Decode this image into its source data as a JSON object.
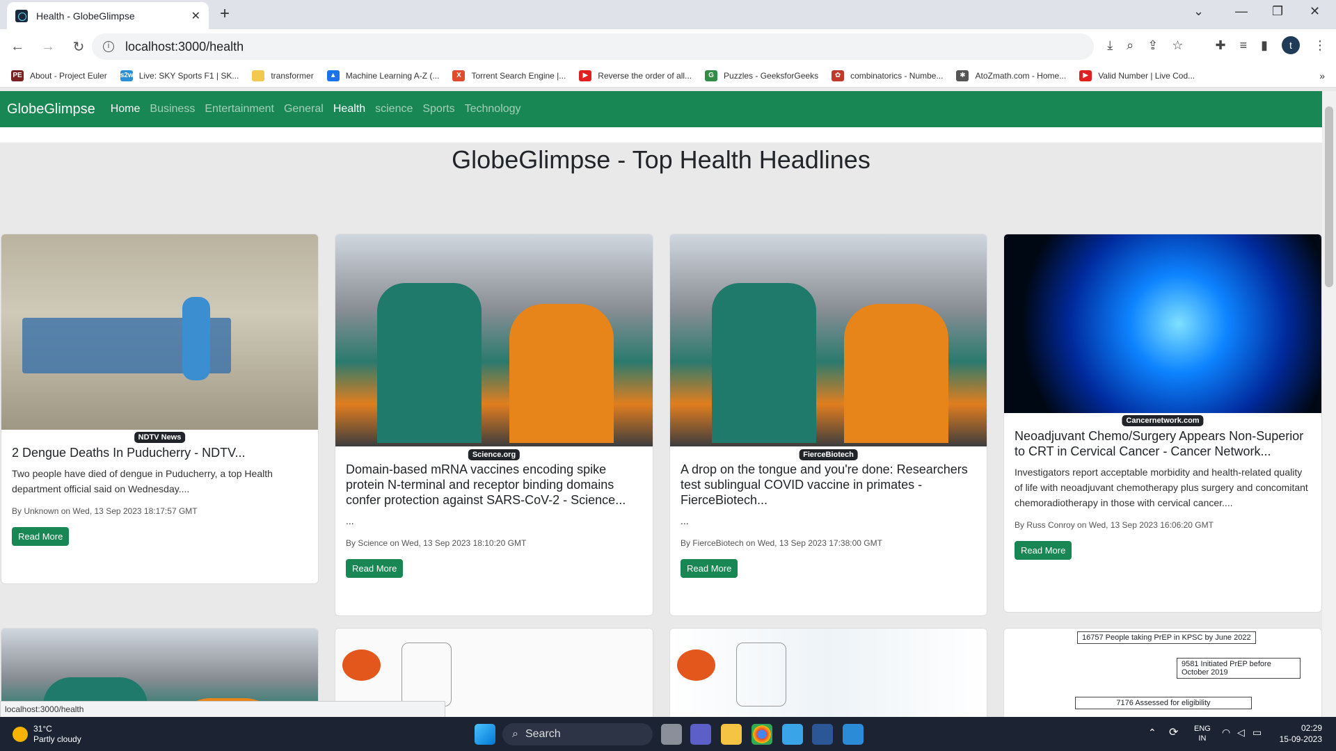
{
  "browser": {
    "tab_title": "Health - GlobeGlimpse",
    "url": "localhost:3000/health",
    "avatar": "t",
    "status_url": "localhost:3000/health"
  },
  "bookmarks": [
    {
      "label": "About - Project Euler",
      "icon": "PE",
      "color": "#7a2222"
    },
    {
      "label": "Live: SKY Sports F1 | SK...",
      "icon": "s2w",
      "color": "#2a8fd4"
    },
    {
      "label": "transformer",
      "icon": "",
      "color": "#f2c94c"
    },
    {
      "label": "Machine Learning A-Z (...",
      "icon": "▲",
      "color": "#1a73e8"
    },
    {
      "label": "Torrent Search Engine |...",
      "icon": "X",
      "color": "#e04b2d"
    },
    {
      "label": "Reverse the order of all...",
      "icon": "▶",
      "color": "#e02020"
    },
    {
      "label": "Puzzles - GeeksforGeeks",
      "icon": "G",
      "color": "#2f8d46"
    },
    {
      "label": "combinatorics - Numbe...",
      "icon": "✿",
      "color": "#c0392b"
    },
    {
      "label": "AtoZmath.com - Home...",
      "icon": "✱",
      "color": "#555"
    },
    {
      "label": "Valid Number | Live Cod...",
      "icon": "▶",
      "color": "#e02020"
    }
  ],
  "app": {
    "brand": "GlobeGlimpse",
    "nav": [
      "Home",
      "Business",
      "Entertainment",
      "General",
      "Health",
      "science",
      "Sports",
      "Technology"
    ],
    "title": "GlobeGlimpse - Top Health Headlines"
  },
  "cards": [
    {
      "source": "NDTV News",
      "title": "2 Dengue Deaths In Puducherry - NDTV...",
      "desc": "Two people have died of dengue in Puducherry, a top Health department official said on Wednesday....",
      "meta": "By Unknown on Wed, 13 Sep 2023 18:17:57 GMT",
      "button": "Read More"
    },
    {
      "source": "Science.org",
      "title": "Domain-based mRNA vaccines encoding spike protein N-terminal and receptor binding domains confer protection against SARS-CoV-2 - Science...",
      "desc": "...",
      "meta": "By Science on Wed, 13 Sep 2023 18:10:20 GMT",
      "button": "Read More"
    },
    {
      "source": "FierceBiotech",
      "title": "A drop on the tongue and you're done: Researchers test sublingual COVID vaccine in primates - FierceBiotech...",
      "desc": "...",
      "meta": "By FierceBiotech on Wed, 13 Sep 2023 17:38:00 GMT",
      "button": "Read More"
    },
    {
      "source": "Cancernetwork.com",
      "title": "Neoadjuvant Chemo/Surgery Appears Non-Superior to CRT in Cervical Cancer - Cancer Network...",
      "desc": "Investigators report acceptable morbidity and health-related quality of life with neoadjuvant chemotherapy plus surgery and concomitant chemoradiotherapy in those with cervical cancer....",
      "meta": "By Russ Conroy on Wed, 13 Sep 2023 16:06:20 GMT",
      "button": "Read More"
    }
  ],
  "flowchart": {
    "box1": "16757  People taking PrEP in KPSC by June 2022",
    "box2": "9581  Initiated PrEP before October 2019",
    "box3": "7176  Assessed for eligibility"
  },
  "taskbar": {
    "temp": "31°C",
    "weather": "Partly cloudy",
    "search": "Search",
    "lang1": "ENG",
    "lang2": "IN",
    "time": "02:29",
    "date": "15-09-2023"
  }
}
